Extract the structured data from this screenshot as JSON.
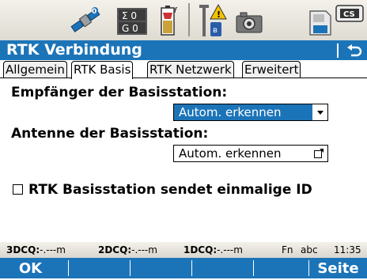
{
  "status_icons": [
    "satellite-icon",
    "sigma-icon",
    "battery-icon",
    "radio-icon",
    "camera-icon",
    "memory-card-icon",
    "cs-icon"
  ],
  "status": {
    "sigma_top": "Σ 0",
    "sigma_bottom": "G 0",
    "cs_label": "CS"
  },
  "window": {
    "title": "RTK Verbindung"
  },
  "tabs": [
    {
      "label": "Allgemein",
      "active": false
    },
    {
      "label": "RTK Basis",
      "active": true
    },
    {
      "label": "RTK Netzwerk",
      "active": false
    },
    {
      "label": "Erweitert",
      "active": false
    }
  ],
  "form": {
    "receiver_label": "Empfänger der Basisstation:",
    "receiver_value": "Autom. erkennen",
    "antenna_label": "Antenne der Basisstation:",
    "antenna_value": "Autom. erkennen",
    "unique_id_label": "RTK Basisstation sendet einmalige ID",
    "unique_id_checked": false
  },
  "infobar": {
    "dcq3_label": "3DCQ:",
    "dcq3_value": "-.---m",
    "dcq2_label": "2DCQ:",
    "dcq2_value": "-.---m",
    "dcq1_label": "1DCQ:",
    "dcq1_value": "-.---m",
    "fn": "Fn",
    "input_mode": "abc",
    "time": "11:35"
  },
  "softkeys": {
    "f1": "OK",
    "f2": "",
    "f3": "",
    "f4": "",
    "f5": "",
    "f6": "Seite"
  },
  "colors": {
    "accent": "#1c74b8",
    "status_bar": "#e8e5de"
  }
}
